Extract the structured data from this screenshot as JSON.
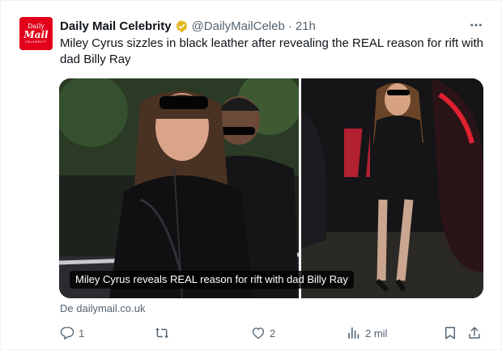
{
  "tweet": {
    "avatar": {
      "line1": "Daily",
      "line2": "Mail",
      "line3": "CELEBRITY",
      "color": "#e2001a"
    },
    "display_name": "Daily Mail Celebrity",
    "handle": "@DailyMailCeleb",
    "separator": "·",
    "time": "21h",
    "verified_color": "#e2b719",
    "text": "Miley Cyrus sizzles in black leather after revealing the REAL reason for rift with dad Billy Ray",
    "card": {
      "caption": "Miley Cyrus reveals REAL reason for rift with dad Billy Ray",
      "source": "De dailymail.co.uk"
    },
    "actions": {
      "reply_count": "1",
      "retweet_count": "",
      "like_count": "2",
      "views_count": "2 mil"
    }
  },
  "icons": [
    "more-icon",
    "verified-badge-icon",
    "reply-icon",
    "retweet-icon",
    "like-icon",
    "views-icon",
    "bookmark-icon",
    "share-icon"
  ]
}
